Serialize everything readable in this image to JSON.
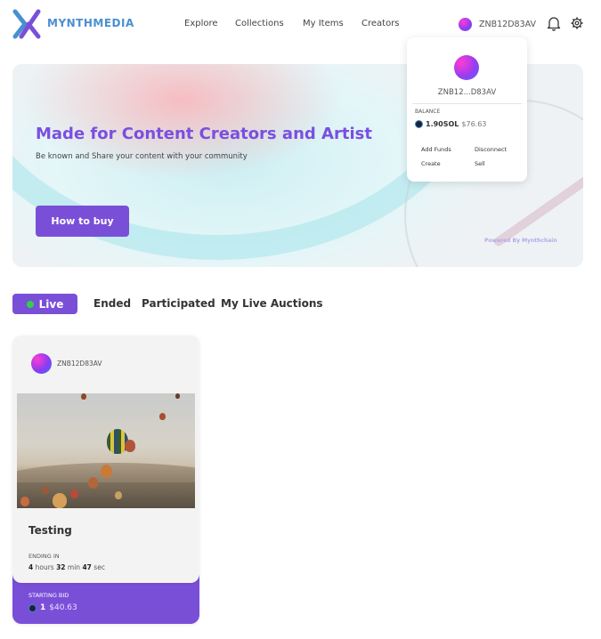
{
  "header": {
    "brand": "MYNTHMEDIA",
    "nav": [
      "Explore",
      "Collections",
      "My Items",
      "Creators"
    ],
    "user_id": "ZNB12D83AV"
  },
  "wallet_popup": {
    "name": "ZNB12...D83AV",
    "balance_label": "BALANCE",
    "balance_sol": "1.90SOL",
    "balance_usd": "$76.63",
    "links": [
      "Add Funds",
      "Disconnect",
      "Create",
      "Sell"
    ]
  },
  "banner": {
    "title": "Made for Content Creators and Artist",
    "subtitle": "Be known and Share your content with your community",
    "button": "How to buy",
    "powered_by": "Powered By Mynthchain"
  },
  "tabs": [
    "Live",
    "Ended",
    "Participated",
    "My Live Auctions"
  ],
  "auction_card": {
    "user": "ZNB12D83AV",
    "title": "Testing",
    "ending_label": "ENDING IN",
    "ending": {
      "hours": "4",
      "hours_unit": "hours",
      "min": "32",
      "min_unit": "min",
      "sec": "47",
      "sec_unit": "sec"
    },
    "bid_label": "STARTING BID",
    "bid_sol": "1",
    "bid_usd": "$40.63"
  },
  "colors": {
    "accent": "#7a4fd8",
    "brand": "#4a8fd0",
    "live": "#2bd24a"
  },
  "icons": [
    "logo-icon",
    "bell-icon",
    "gear-icon",
    "sol-icon"
  ]
}
